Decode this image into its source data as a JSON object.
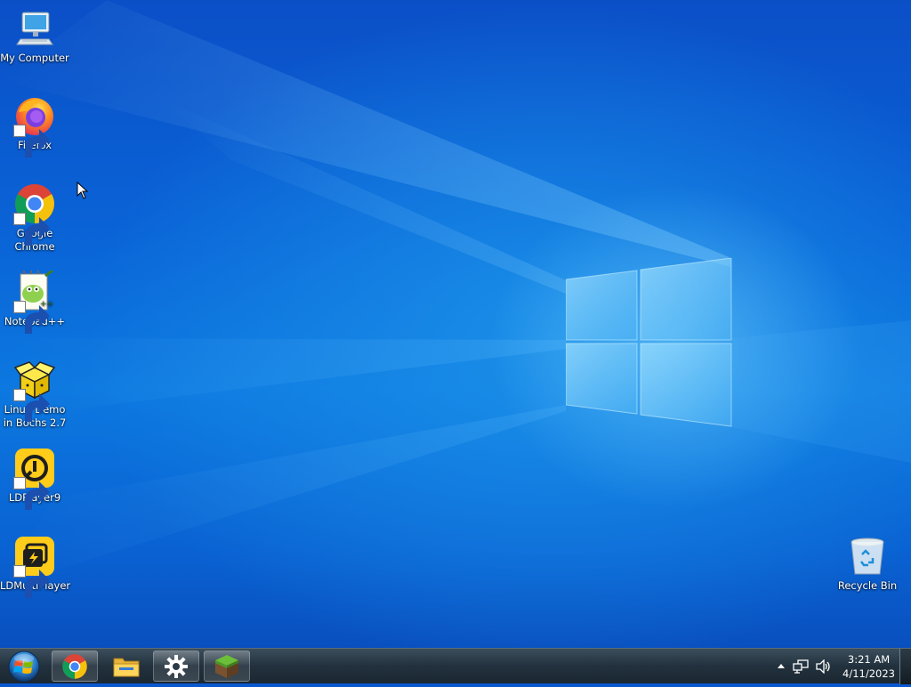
{
  "desktop": {
    "icons": [
      {
        "label": "My Computer",
        "icon": "my-computer-icon"
      },
      {
        "label": "Firefox",
        "icon": "firefox-icon"
      },
      {
        "label": "Google Chrome",
        "icon": "chrome-icon"
      },
      {
        "label": "Notepad++",
        "icon": "notepadpp-icon"
      },
      {
        "label": "Linux Demo in Bochs 2.7",
        "icon": "bochs-icon"
      },
      {
        "label": "LDPlayer9",
        "icon": "ldplayer-icon"
      },
      {
        "label": "LDMultiPlayer",
        "icon": "ldmultiplayer-icon"
      },
      {
        "label": "Recycle Bin",
        "icon": "recycle-bin-icon"
      }
    ]
  },
  "taskbar": {
    "start": "windows-start-orb-icon",
    "pinned": [
      {
        "app": "Google Chrome",
        "icon": "chrome-icon"
      },
      {
        "app": "File Explorer",
        "icon": "folder-icon"
      },
      {
        "app": "Settings",
        "icon": "gear-icon"
      },
      {
        "app": "Minecraft",
        "icon": "grass-block-icon"
      }
    ],
    "tray": {
      "icons": [
        "chevron-up-icon",
        "network-icon",
        "volume-icon"
      ],
      "time": "3:21 AM",
      "date": "4/11/2023"
    }
  },
  "colors": {
    "wallpaper": "#0a63d6",
    "taskbar": "#22313d"
  }
}
